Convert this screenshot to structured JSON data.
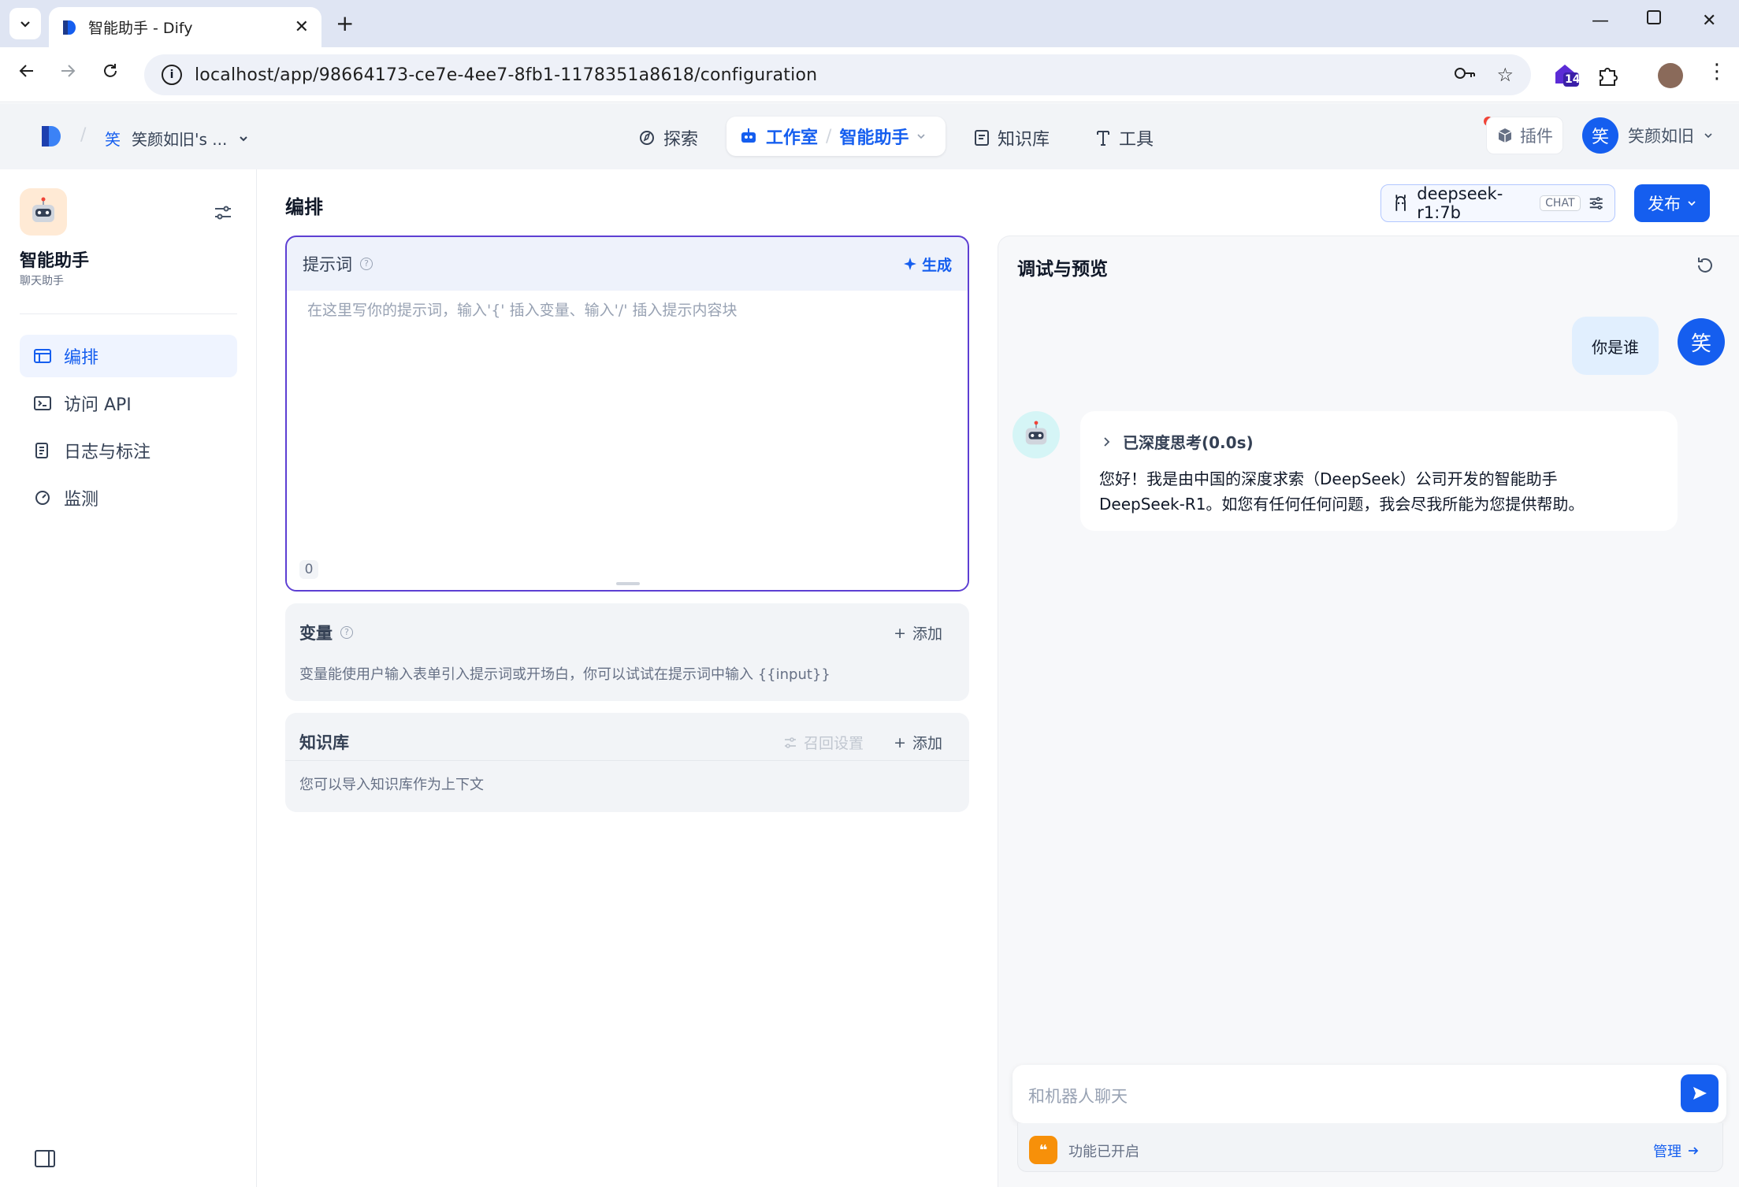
{
  "browser": {
    "tab_title": "智能助手 - Dify",
    "url": "localhost/app/98664173-ce7e-4ee7-8fb1-1178351a8618/configuration",
    "extension_badge": "14"
  },
  "header": {
    "workspace_initial": "笑",
    "workspace_name": "笑颜如旧's ...",
    "nav": {
      "explore": "探索",
      "studio": "工作室",
      "current_app": "智能助手",
      "knowledge": "知识库",
      "tools": "工具"
    },
    "plugins": "插件",
    "user_initial": "笑",
    "user_name": "笑颜如旧"
  },
  "sidebar": {
    "app_name": "智能助手",
    "app_type": "聊天助手",
    "items": [
      {
        "label": "编排",
        "icon": "layout-icon",
        "active": true
      },
      {
        "label": "访问 API",
        "icon": "terminal-icon",
        "active": false
      },
      {
        "label": "日志与标注",
        "icon": "log-icon",
        "active": false
      },
      {
        "label": "监测",
        "icon": "monitor-icon",
        "active": false
      }
    ]
  },
  "main": {
    "title": "编排",
    "model": {
      "name": "deepseek-r1:7b",
      "mode": "CHAT"
    },
    "publish": "发布",
    "prompt": {
      "label": "提示词",
      "generate": "生成",
      "placeholder": "在这里写你的提示词，输入'{' 插入变量、输入'/' 插入提示内容块",
      "char_count": "0"
    },
    "variables": {
      "title": "变量",
      "add": "添加",
      "desc": "变量能使用户输入表单引入提示词或开场白，你可以试试在提示词中输入 {{input}}"
    },
    "knowledge": {
      "title": "知识库",
      "recall": "召回设置",
      "add": "添加",
      "desc": "您可以导入知识库作为上下文"
    }
  },
  "debug": {
    "title": "调试与预览",
    "user_message": "你是谁",
    "user_initial": "笑",
    "thinking": "已深度思考(0.0s)",
    "answer_line1": "您好！我是由中国的深度求索（DeepSeek）公司开发的智能助手",
    "answer_line2": "DeepSeek-R1。如您有任何任何问题，我会尽我所能为您提供帮助。",
    "input_placeholder": "和机器人聊天",
    "features_text": "功能已开启",
    "manage": "管理"
  },
  "colors": {
    "primary": "#155eef",
    "prompt_border": "#5d3fd3",
    "feature_icon": "#f79009"
  }
}
